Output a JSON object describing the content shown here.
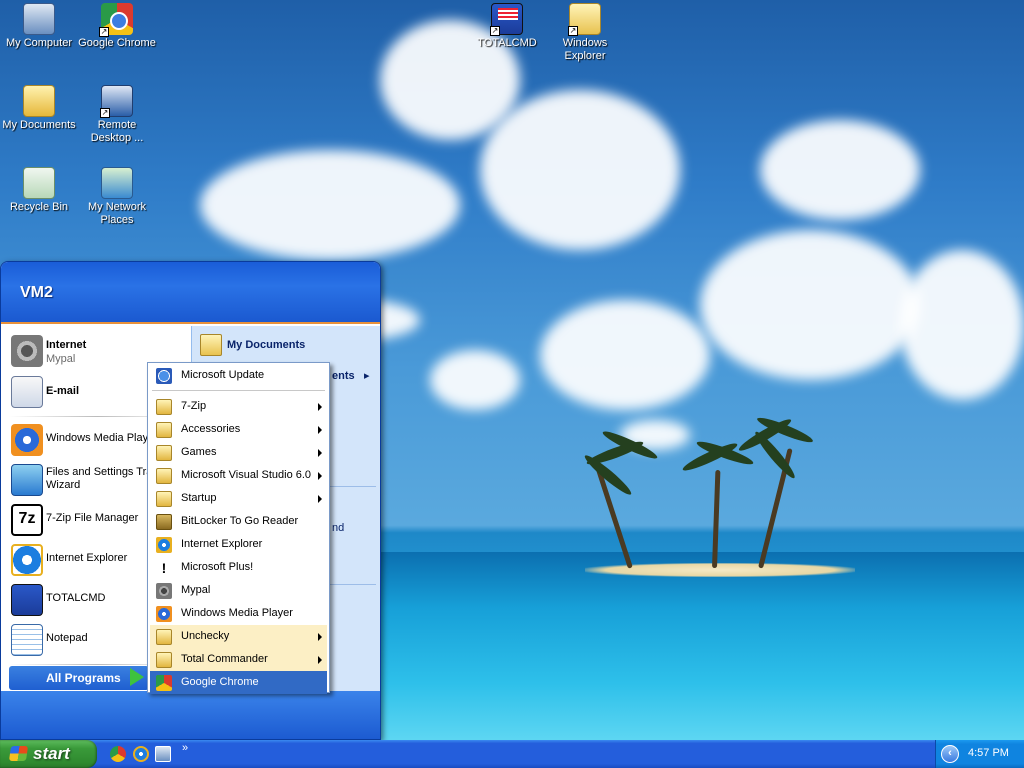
{
  "desktop": {
    "icons": [
      {
        "label": "My Computer",
        "icon": "computer-icon"
      },
      {
        "label": "Google Chrome",
        "icon": "chrome-icon"
      },
      {
        "label": "My Documents",
        "icon": "documents-folder-icon"
      },
      {
        "label": "Remote Desktop ...",
        "icon": "remote-desktop-icon"
      },
      {
        "label": "Recycle Bin",
        "icon": "recycle-bin-icon"
      },
      {
        "label": "My Network Places",
        "icon": "network-places-icon"
      },
      {
        "label": "TOTALCMD",
        "icon": "totalcmd-icon"
      },
      {
        "label": "Windows Explorer",
        "icon": "explorer-folder-icon"
      }
    ]
  },
  "start_menu": {
    "user_name": "VM2",
    "pinned": [
      {
        "title": "Internet",
        "subtitle": "Mypal"
      },
      {
        "title": "E-mail",
        "subtitle": ""
      }
    ],
    "recent": [
      {
        "label": "Windows Media Player"
      },
      {
        "label": "Files and Settings Transfer",
        "label2": "Wizard"
      },
      {
        "label": "7-Zip File Manager"
      },
      {
        "label": "Internet Explorer"
      },
      {
        "label": "TOTALCMD"
      },
      {
        "label": "Notepad"
      }
    ],
    "all_programs_label": "All Programs",
    "right": {
      "my_documents": "My Documents",
      "my_recent_fragment": "ents",
      "fragment_2": "nd"
    }
  },
  "programs_submenu": {
    "top_item": "Microsoft Update",
    "items": [
      {
        "label": "7-Zip",
        "has_submenu": true,
        "icon": "folder-icon"
      },
      {
        "label": "Accessories",
        "has_submenu": true,
        "icon": "folder-icon"
      },
      {
        "label": "Games",
        "has_submenu": true,
        "icon": "folder-icon"
      },
      {
        "label": "Microsoft Visual Studio 6.0",
        "has_submenu": true,
        "icon": "folder-icon"
      },
      {
        "label": "Startup",
        "has_submenu": true,
        "icon": "folder-icon"
      },
      {
        "label": "BitLocker To Go Reader",
        "has_submenu": false,
        "icon": "bitlocker-icon"
      },
      {
        "label": "Internet Explorer",
        "has_submenu": false,
        "icon": "ie-icon"
      },
      {
        "label": "Microsoft Plus!",
        "has_submenu": false,
        "icon": "plus-icon"
      },
      {
        "label": "Mypal",
        "has_submenu": false,
        "icon": "mypal-icon"
      },
      {
        "label": "Windows Media Player",
        "has_submenu": false,
        "icon": "wmp-icon"
      },
      {
        "label": "Unchecky",
        "has_submenu": true,
        "icon": "folder-icon"
      },
      {
        "label": "Total Commander",
        "has_submenu": true,
        "icon": "folder-icon"
      },
      {
        "label": "Google Chrome",
        "has_submenu": false,
        "icon": "chrome-icon"
      }
    ]
  },
  "taskbar": {
    "start_label": "start",
    "quick_launch_more": "»",
    "clock": "4:57 PM"
  },
  "colors": {
    "taskbar_blue": "#245edc",
    "start_green": "#3a9a3a",
    "selection_blue": "#316ac5",
    "new_item_highlight": "#fcefc5"
  }
}
